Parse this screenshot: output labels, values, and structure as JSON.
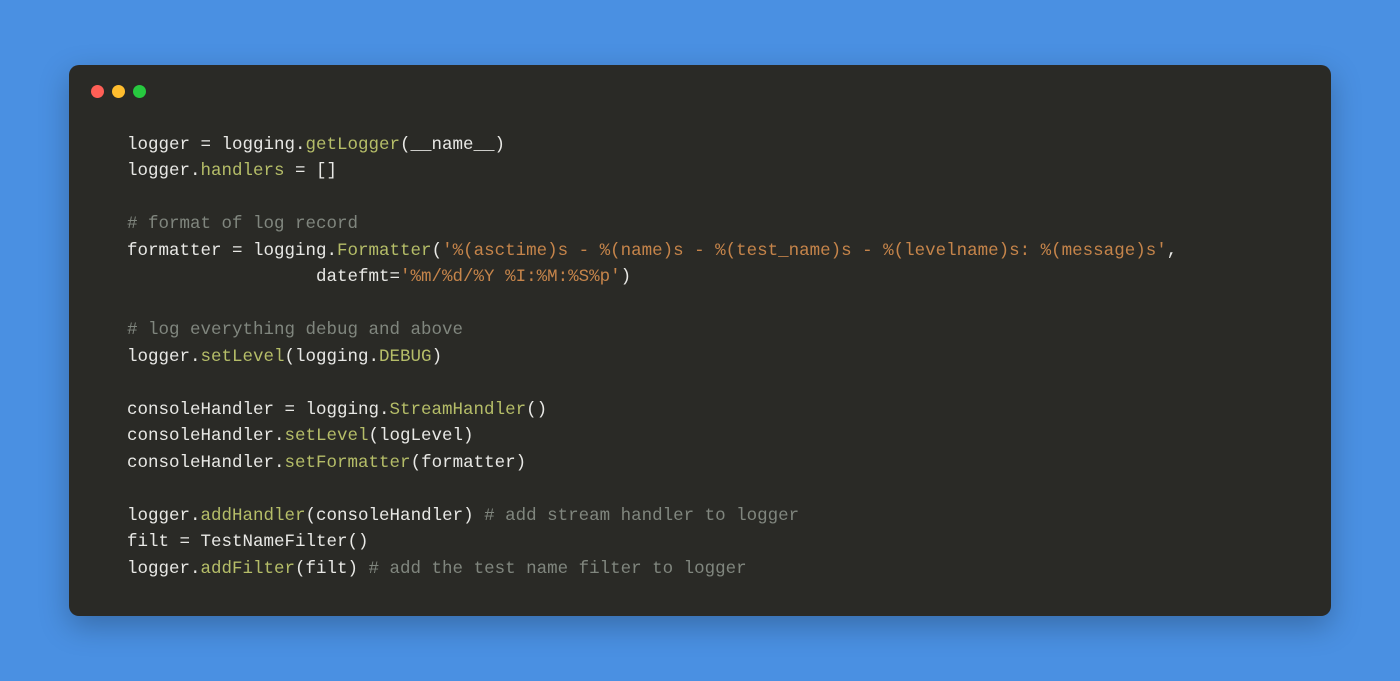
{
  "colors": {
    "bg": "#4a90e2",
    "window": "#2a2a26",
    "text": "#e8e8e5",
    "comment": "#80867e",
    "fn": "#b5bd68",
    "str": "#c5844a",
    "dot_red": "#ff5f56",
    "dot_yellow": "#ffbd2e",
    "dot_green": "#27c93f"
  },
  "t": {
    "l1a": "logger = logging.",
    "l1b": "getLogger",
    "l1c": "(__name__)",
    "l2a": "logger.",
    "l2b": "handlers",
    "l2c": " = []",
    "c1": "# format of log record",
    "l3a": "formatter = logging.",
    "l3b": "Formatter",
    "l3c": "(",
    "l3d": "'%(asctime)s - %(name)s - %(test_name)s - %(levelname)s: %(message)s'",
    "l3e": ",",
    "l4a": "                  datefmt=",
    "l4b": "'%m/%d/%Y %I:%M:%S%p'",
    "l4c": ")",
    "c2": "# log everything debug and above",
    "l5a": "logger.",
    "l5b": "setLevel",
    "l5c": "(logging.",
    "l5d": "DEBUG",
    "l5e": ")",
    "l6a": "consoleHandler = logging.",
    "l6b": "StreamHandler",
    "l6c": "()",
    "l7a": "consoleHandler.",
    "l7b": "setLevel",
    "l7c": "(logLevel)",
    "l8a": "consoleHandler.",
    "l8b": "setFormatter",
    "l8c": "(formatter)",
    "l9a": "logger.",
    "l9b": "addHandler",
    "l9c": "(consoleHandler) ",
    "c3": "# add stream handler to logger",
    "l10": "filt = TestNameFilter()",
    "l11a": "logger.",
    "l11b": "addFilter",
    "l11c": "(filt) ",
    "c4": "# add the test name filter to logger"
  }
}
